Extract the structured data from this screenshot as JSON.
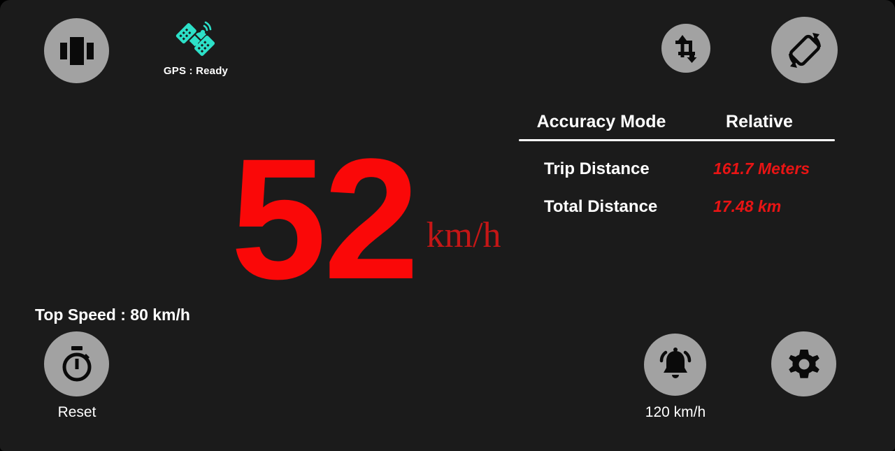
{
  "app": {
    "background_color": "#1b1b1b",
    "circle_button_color": "#a2a2a2",
    "accent_red": "#fa0808",
    "gps_icon_color": "#2de0c8"
  },
  "topbar": {
    "layout_button": {
      "icon": "view-carousel-icon",
      "label": ""
    },
    "crop_button": {
      "icon": "crop-resize-icon",
      "label": ""
    },
    "rotate_button": {
      "icon": "screen-rotation-icon",
      "label": ""
    }
  },
  "gps": {
    "icon": "satellite-icon",
    "status_label": "GPS : Ready"
  },
  "speed": {
    "value": "52",
    "unit": "km/h"
  },
  "info": {
    "header": {
      "key": "Accuracy Mode",
      "value": "Relative"
    },
    "rows": [
      {
        "key": "Trip Distance",
        "value": "161.7 Meters"
      },
      {
        "key": "Total Distance",
        "value": "17.48 km"
      }
    ]
  },
  "top_speed": {
    "label": "Top Speed : 80 km/h"
  },
  "reset": {
    "icon": "stopwatch-icon",
    "label": "Reset"
  },
  "alarm": {
    "icon": "bell-icon",
    "label": "120 km/h"
  },
  "settings": {
    "icon": "gear-icon",
    "label": ""
  }
}
